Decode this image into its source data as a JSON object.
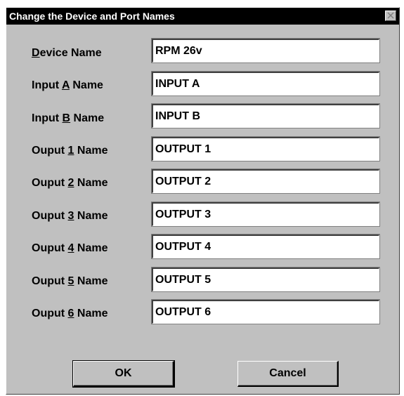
{
  "dialog": {
    "title": "Change the Device and Port Names",
    "close_icon": "close-icon"
  },
  "rows": [
    {
      "pre": "",
      "acc": "D",
      "post": "evice Name",
      "value": "RPM 26v"
    },
    {
      "pre": "Input ",
      "acc": "A",
      "post": " Name",
      "value": "INPUT A"
    },
    {
      "pre": "Input ",
      "acc": "B",
      "post": " Name",
      "value": "INPUT B"
    },
    {
      "pre": "Ouput ",
      "acc": "1",
      "post": " Name",
      "value": "OUTPUT 1"
    },
    {
      "pre": "Ouput ",
      "acc": "2",
      "post": " Name",
      "value": "OUTPUT 2"
    },
    {
      "pre": "Ouput ",
      "acc": "3",
      "post": " Name",
      "value": "OUTPUT 3"
    },
    {
      "pre": "Ouput ",
      "acc": "4",
      "post": " Name",
      "value": "OUTPUT 4"
    },
    {
      "pre": "Ouput ",
      "acc": "5",
      "post": " Name",
      "value": "OUTPUT 5"
    },
    {
      "pre": "Ouput ",
      "acc": "6",
      "post": " Name",
      "value": "OUTPUT 6"
    }
  ],
  "buttons": {
    "ok_label": "OK",
    "cancel_label": "Cancel"
  }
}
